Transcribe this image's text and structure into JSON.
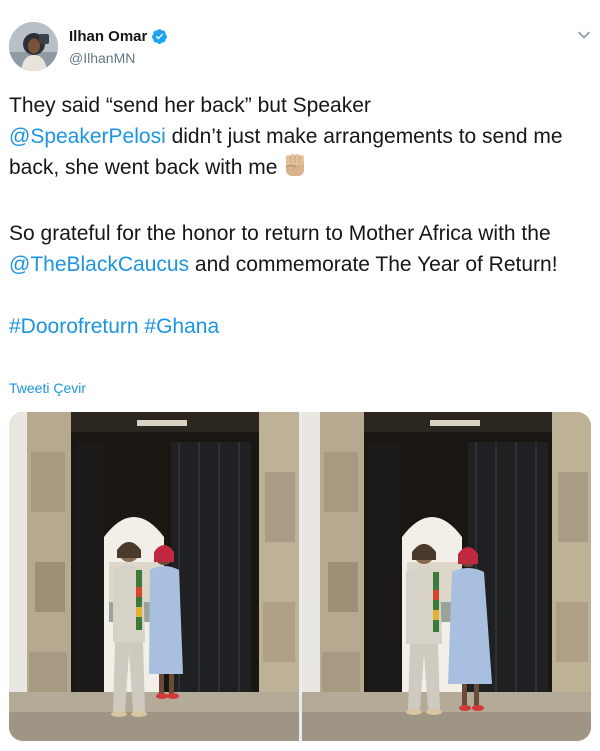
{
  "author": {
    "name": "Ilhan Omar",
    "handle": "@IlhanMN",
    "verified": true
  },
  "tweet": {
    "line1_pre": "They said “send her back” but Speaker",
    "mention1": "@SpeakerPelosi",
    "line2_post": " didn’t just make arrangements to send me back, she went back with me",
    "emoji_icon": "raised-fist-medium-skin-tone",
    "para2_pre": "So grateful for the honor to return to Mother Africa with the ",
    "mention2": "@TheBlackCaucus",
    "para2_post": " and  commemorate The Year of Return!",
    "hashtag1": "#Doorofreturn",
    "hashtag2": "#Ghana"
  },
  "actions": {
    "translate_label": "Tweeti Çevir"
  },
  "media": {
    "sign_text": "DOOR OF RETURN",
    "photo_count": 2
  },
  "colors": {
    "link": "#1b95e0",
    "text": "#14171a",
    "secondary": "#657786"
  }
}
